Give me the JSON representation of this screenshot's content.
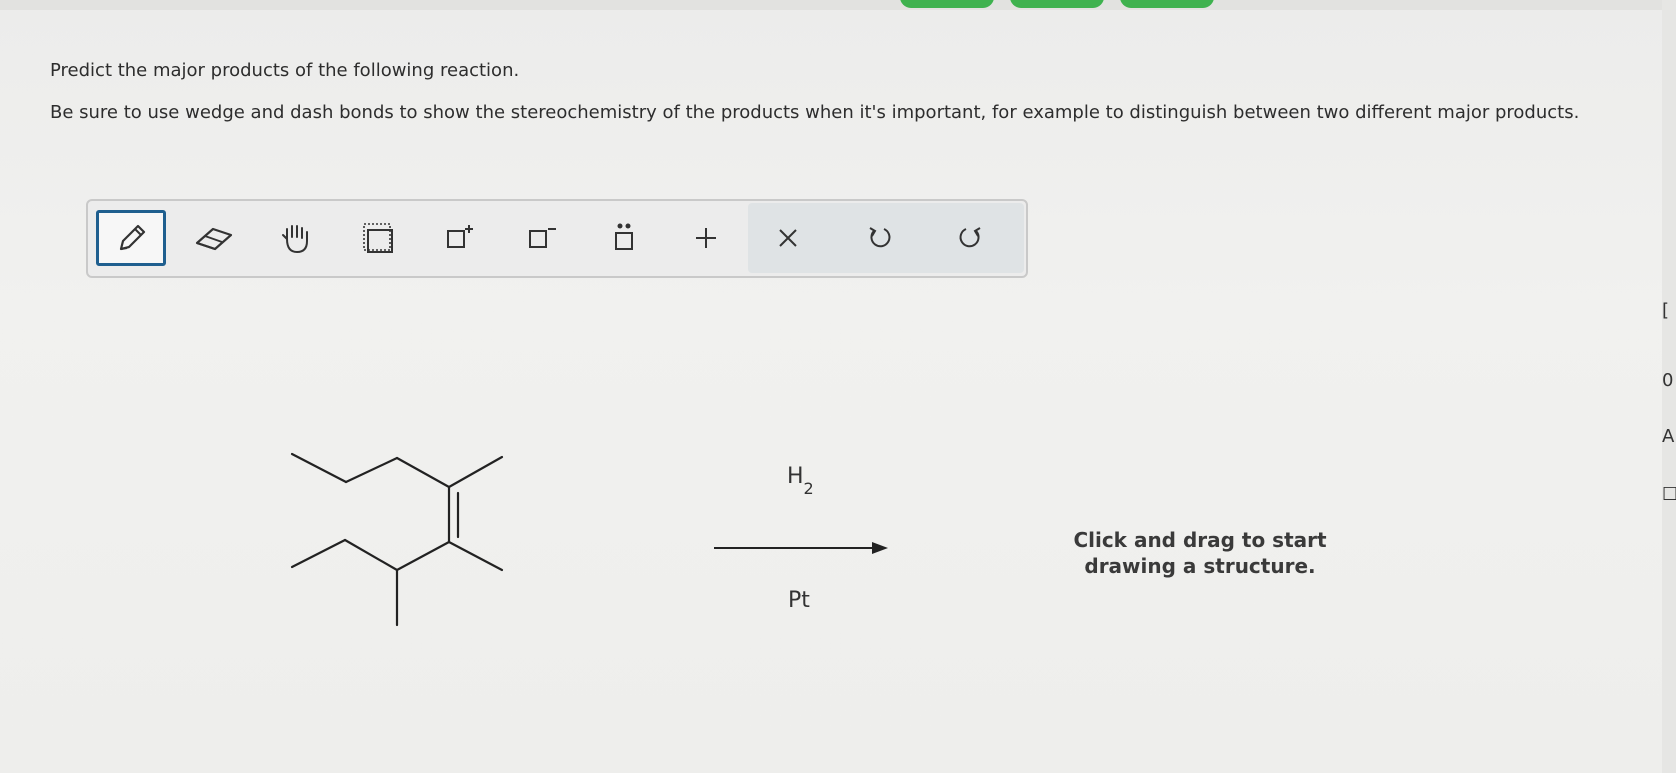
{
  "question": {
    "prompt": "Predict the major products of the following reaction.",
    "instructions": "Be sure to use wedge and dash bonds to show the stereochemistry of the products when it's important, for example to distinguish between two different major products."
  },
  "toolbar": {
    "selected_tool": "pencil-icon",
    "tools": [
      "pencil-icon",
      "eraser-icon",
      "hand-icon",
      "selection-icon",
      "positive-charge-icon",
      "negative-charge-icon",
      "lone-pair-icon",
      "plus-icon",
      "clear-icon",
      "undo-icon",
      "redo-icon"
    ]
  },
  "reaction": {
    "reagent_above": "H",
    "reagent_above_sub": "2",
    "reagent_below": "Pt"
  },
  "canvas": {
    "hint_line1": "Click and drag to start",
    "hint_line2": "drawing a structure."
  },
  "right_edge_glyphs": [
    "[",
    "0",
    "A",
    "☐"
  ],
  "colors": {
    "selected_border": "#1f5f8f",
    "tab_green": "#3fb24f"
  }
}
